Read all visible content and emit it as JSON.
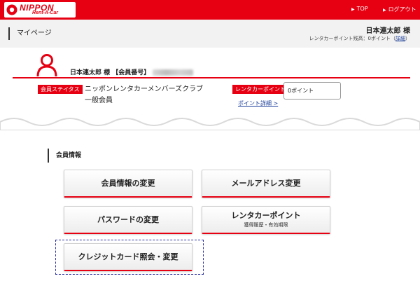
{
  "header": {
    "logo_top": "NIPPON",
    "logo_bottom": "Rent-A-Car",
    "links": {
      "top": "TOP",
      "logout": "ログアウト"
    }
  },
  "page": {
    "title": "マイページ",
    "user_name": "日本連太郎 様",
    "points_summary_prefix": "レンタカーポイント残高：0ポイント（",
    "points_summary_link": "詳細",
    "points_summary_suffix": "）"
  },
  "member": {
    "name_line": "日本連太郎 様 【会員番号】",
    "status_label": "会員ステイタス",
    "status_line1": "ニッポンレンタカーメンバーズクラブ",
    "status_line2": "一般会員",
    "points_label": "レンタカーポイント",
    "points_value": "0ポイント",
    "points_detail_link": "ポイント詳細 >"
  },
  "section": {
    "title": "会員情報",
    "buttons": {
      "edit_member": "会員情報の変更",
      "change_email": "メールアドレス変更",
      "change_password": "パスワードの変更",
      "rentacar_points": "レンタカーポイント",
      "rentacar_points_sub": "獲得履歴・有効期限",
      "credit_card": "クレジットカード照会・変更"
    }
  },
  "colors": {
    "brand_red": "#e60012",
    "link_blue": "#1a3d99",
    "highlight_border": "#2a2f9e"
  }
}
